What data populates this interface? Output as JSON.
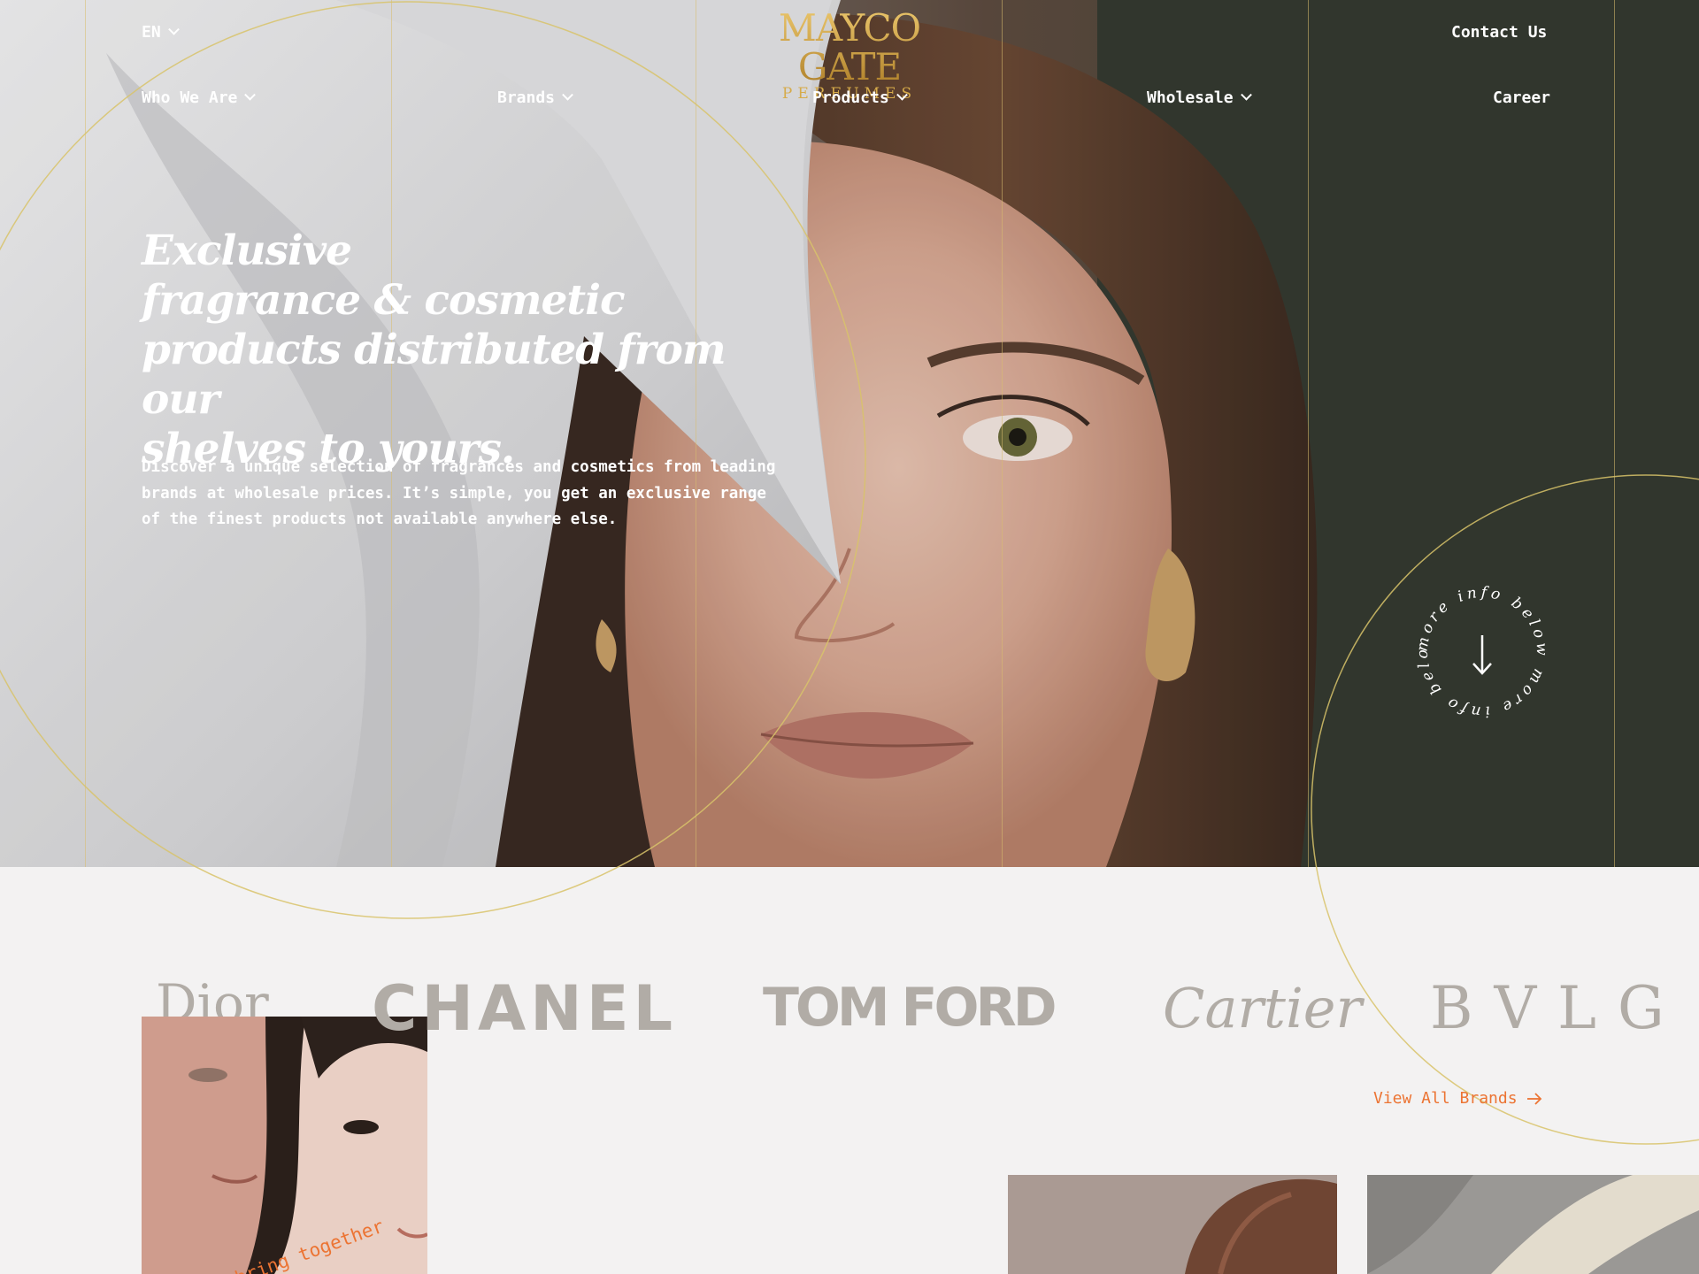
{
  "header": {
    "logo_main": "MAYCO GATE",
    "logo_sub": "PERFUMES",
    "language": "EN",
    "contact": "Contact Us"
  },
  "nav": {
    "items": [
      {
        "label": "Who We Are",
        "has_dropdown": true
      },
      {
        "label": "Brands",
        "has_dropdown": true
      },
      {
        "label": "Products",
        "has_dropdown": true
      },
      {
        "label": "Wholesale",
        "has_dropdown": true
      },
      {
        "label": "Career",
        "has_dropdown": false
      }
    ]
  },
  "hero": {
    "title_lines": [
      "Exclusive",
      "fragrance & cosmetic",
      "products distributed from our",
      "shelves to yours."
    ],
    "description": "Discover a unique selection of fragrances and cosmetics from leading brands at wholesale prices. It’s simple, you get an exclusive range of the finest products not available anywhere else.",
    "more_info_text": "more info below more info below "
  },
  "brands": {
    "logos": [
      "Dior",
      "CHANEL",
      "TOM FORD",
      "Cartier",
      "BVLG"
    ],
    "view_all": "View All Brands"
  },
  "photos": {
    "couple_caption": "bring together"
  },
  "colors": {
    "gold": "#c79a34",
    "gold_line": "#d8be6e",
    "accent_orange": "#ec7433",
    "brand_gray": "#b1aca6",
    "page_bg": "#f3f2f2"
  }
}
